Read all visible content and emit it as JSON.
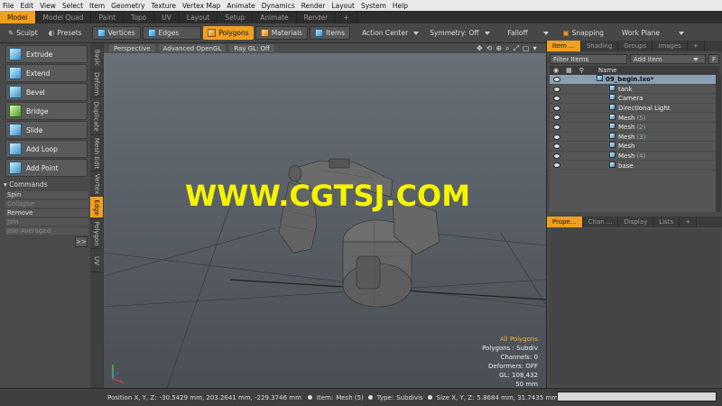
{
  "menu": [
    "File",
    "Edit",
    "View",
    "Select",
    "Item",
    "Geometry",
    "Texture",
    "Vertex Map",
    "Animate",
    "Dynamics",
    "Render",
    "Layout",
    "System",
    "Help"
  ],
  "layout_tabs": [
    {
      "label": "Model",
      "active": true
    },
    {
      "label": "Model Quad",
      "active": false
    },
    {
      "label": "Paint",
      "active": false
    },
    {
      "label": "Topo",
      "active": false
    },
    {
      "label": "UV",
      "active": false
    },
    {
      "label": "Layout",
      "active": false
    },
    {
      "label": "Setup",
      "active": false
    },
    {
      "label": "Animate",
      "active": false
    },
    {
      "label": "Render",
      "active": false
    },
    {
      "label": "+",
      "active": false
    }
  ],
  "toolbar": {
    "sculpt": "Sculpt",
    "presets": "Presets",
    "vertices": "Vertices",
    "edges": "Edges",
    "polygons": "Polygons",
    "materials": "Materials",
    "items": "Items",
    "action_center": "Action Center",
    "symmetry": "Symmetry: Off",
    "falloff": "Falloff",
    "snapping": "Snapping",
    "work_plane": "Work Plane"
  },
  "tools": [
    "Extrude",
    "Extend",
    "Bevel",
    "Bridge",
    "Slide",
    "Add Loop",
    "Add Point"
  ],
  "commands": {
    "header": "Commands",
    "items": [
      {
        "label": "Spin",
        "dim": false
      },
      {
        "label": "Collapse",
        "dim": true
      },
      {
        "label": "Remove",
        "dim": false
      },
      {
        "label": "Join",
        "dim": true
      },
      {
        "label": "Join Averaged",
        "dim": true
      }
    ]
  },
  "expand_label": ">>",
  "side_tabs": [
    {
      "label": "Basic",
      "active": false
    },
    {
      "label": "Deform",
      "active": false
    },
    {
      "label": "Duplicate",
      "active": false
    },
    {
      "label": "Mesh Edit",
      "active": false
    },
    {
      "label": "Vertex",
      "active": false
    },
    {
      "label": "Edge",
      "active": true
    },
    {
      "label": "Polygon",
      "active": false
    },
    {
      "label": "UV",
      "active": false
    }
  ],
  "viewport": {
    "perspective": "Perspective",
    "shading": "Advanced OpenGL",
    "raygl": "Ray GL: Off",
    "watermark": "WWW.CGTSJ.COM",
    "info": [
      "All Polygons",
      "Polygons : Subdiv",
      "Channels: 0",
      "Deformers: OFF",
      "GL: 108,432",
      "50 mm"
    ]
  },
  "right_tabs_top": [
    {
      "label": "Item ...",
      "active": true
    },
    {
      "label": "Shading",
      "active": false
    },
    {
      "label": "Groups",
      "active": false
    },
    {
      "label": "Images",
      "active": false
    },
    {
      "label": "+",
      "active": false
    }
  ],
  "filter_label": "Filter Items",
  "add_item_label": "Add Item",
  "filter_f": "F",
  "item_header": "Name",
  "items": [
    {
      "name": "09_begin.lxo*",
      "suffix": "",
      "selected": true,
      "indent": 0
    },
    {
      "name": "tank",
      "suffix": "",
      "selected": false,
      "indent": 1
    },
    {
      "name": "Camera",
      "suffix": "",
      "selected": false,
      "indent": 1
    },
    {
      "name": "Directional Light",
      "suffix": "",
      "selected": false,
      "indent": 1
    },
    {
      "name": "Mesh",
      "suffix": "(5)",
      "selected": false,
      "indent": 1
    },
    {
      "name": "Mesh",
      "suffix": "(2)",
      "selected": false,
      "indent": 1
    },
    {
      "name": "Mesh",
      "suffix": "(3)",
      "selected": false,
      "indent": 1
    },
    {
      "name": "Mesh",
      "suffix": "",
      "selected": false,
      "indent": 1
    },
    {
      "name": "Mesh",
      "suffix": "(4)",
      "selected": false,
      "indent": 1
    },
    {
      "name": "base",
      "suffix": "",
      "selected": false,
      "indent": 1
    }
  ],
  "right_tabs_bottom": [
    {
      "label": "Prope...",
      "active": true
    },
    {
      "label": "Chan ...",
      "active": false
    },
    {
      "label": "Display",
      "active": false
    },
    {
      "label": "Lists",
      "active": false
    },
    {
      "label": "+",
      "active": false
    }
  ],
  "status": {
    "position_label": "Position X, Y, Z:",
    "position_value": "-30.5429 mm, 203.2641 mm, -229.3746 mm",
    "item_label": "Item:",
    "item_value": "Mesh (5)",
    "type_label": "Type:",
    "type_value": "Subdivis",
    "size_label": "Size X, Y, Z:",
    "size_value": "5.8684 mm, 31.7435 mm, 26.8488 mm"
  }
}
